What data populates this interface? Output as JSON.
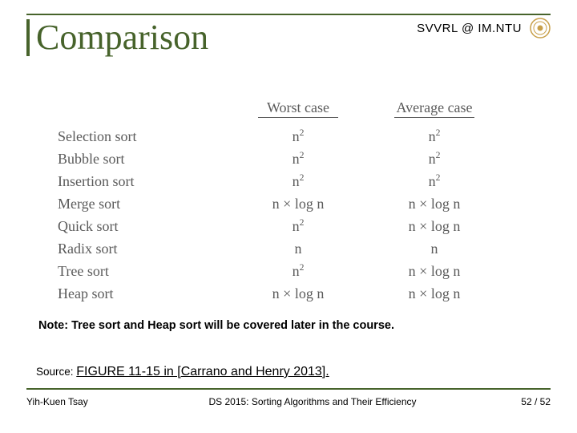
{
  "header": {
    "affiliation": "SVVRL @ IM.NTU",
    "title": "Comparison"
  },
  "chart_data": {
    "type": "table",
    "title": "Comparison",
    "columns": [
      "",
      "Worst case",
      "Average case"
    ],
    "rows": [
      {
        "name": "Selection sort",
        "worst": "n²",
        "avg": "n²"
      },
      {
        "name": "Bubble sort",
        "worst": "n²",
        "avg": "n²"
      },
      {
        "name": "Insertion sort",
        "worst": "n²",
        "avg": "n²"
      },
      {
        "name": "Merge sort",
        "worst": "n × log n",
        "avg": "n × log n"
      },
      {
        "name": "Quick sort",
        "worst": "n²",
        "avg": "n × log n"
      },
      {
        "name": "Radix sort",
        "worst": "n",
        "avg": "n"
      },
      {
        "name": "Tree sort",
        "worst": "n²",
        "avg": "n × log n"
      },
      {
        "name": "Heap sort",
        "worst": "n × log n",
        "avg": "n × log n"
      }
    ]
  },
  "table": {
    "header": {
      "worst": "Worst case",
      "avg": "Average case"
    },
    "rows": {
      "r0": {
        "name": "Selection sort",
        "worst_b": "n",
        "worst_s": "2",
        "avg_b": "n",
        "avg_s": "2"
      },
      "r1": {
        "name": "Bubble sort",
        "worst_b": "n",
        "worst_s": "2",
        "avg_b": "n",
        "avg_s": "2"
      },
      "r2": {
        "name": "Insertion sort",
        "worst_b": "n",
        "worst_s": "2",
        "avg_b": "n",
        "avg_s": "2"
      },
      "r3": {
        "name": "Merge sort",
        "worst_b": "n × log n",
        "worst_s": "",
        "avg_b": "n × log n",
        "avg_s": ""
      },
      "r4": {
        "name": "Quick sort",
        "worst_b": "n",
        "worst_s": "2",
        "avg_b": "n × log n",
        "avg_s": ""
      },
      "r5": {
        "name": "Radix sort",
        "worst_b": "n",
        "worst_s": "",
        "avg_b": "n",
        "avg_s": ""
      },
      "r6": {
        "name": "Tree sort",
        "worst_b": "n",
        "worst_s": "2",
        "avg_b": "n × log n",
        "avg_s": ""
      },
      "r7": {
        "name": "Heap sort",
        "worst_b": "n × log n",
        "worst_s": "",
        "avg_b": "n × log n",
        "avg_s": ""
      }
    }
  },
  "note": "Note: Tree sort and Heap sort will be covered later in the course.",
  "source": {
    "label": "Source: ",
    "text": "FIGURE 11-15 in [Carrano and Henry 2013]."
  },
  "footer": {
    "author": "Yih-Kuen Tsay",
    "course": "DS 2015: Sorting Algorithms and Their Efficiency",
    "page": "52 / 52"
  }
}
